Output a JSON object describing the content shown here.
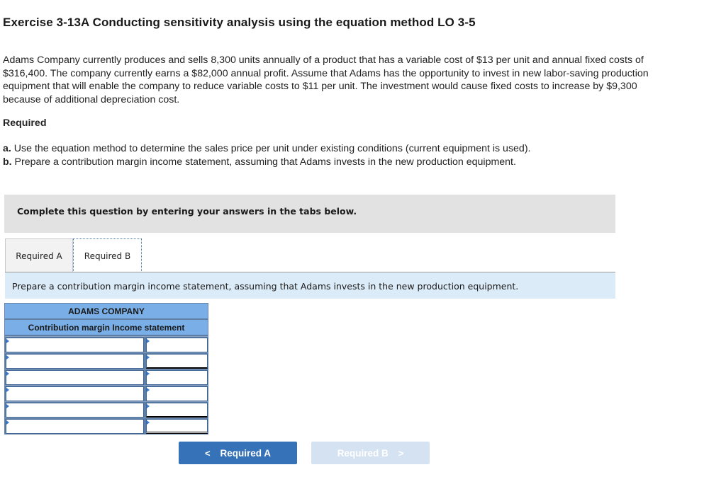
{
  "exercise": {
    "title": "Exercise 3-13A Conducting sensitivity analysis using the equation method LO 3-5",
    "problem_text": "Adams Company currently produces and sells 8,300 units annually of a product that has a variable cost of $13 per unit and annual fixed costs of $316,400. The company currently earns a $82,000 annual profit. Assume that Adams has the opportunity to invest in new labor-saving production equipment that will enable the company to reduce variable costs to $11 per unit. The investment would cause fixed costs to increase by $9,300 because of additional depreciation cost.",
    "required_heading": "Required",
    "requirements": [
      {
        "letter": "a.",
        "text": " Use the equation method to determine the sales price per unit under existing conditions (current equipment is used)."
      },
      {
        "letter": "b.",
        "text": " Prepare a contribution margin income statement, assuming that Adams invests in the new production equipment."
      }
    ]
  },
  "instruction": "Complete this question by entering your answers in the tabs below.",
  "tabs": [
    {
      "label": "Required A",
      "active": false
    },
    {
      "label": "Required B",
      "active": true
    }
  ],
  "prompt": "Prepare a contribution margin income statement, assuming that Adams invests in the new production equipment.",
  "statement": {
    "company": "ADAMS COMPANY",
    "title": "Contribution margin Income statement",
    "rows": [
      {
        "label": "",
        "value": ""
      },
      {
        "label": "",
        "value": ""
      },
      {
        "label": "",
        "value": ""
      },
      {
        "label": "",
        "value": ""
      },
      {
        "label": "",
        "value": ""
      },
      {
        "label": "",
        "value": ""
      }
    ]
  },
  "navigation": {
    "prev_label": "Required A",
    "next_label": "Required B",
    "prev_icon": "chevron-left-icon",
    "next_icon": "chevron-right-icon",
    "prev_glyph": "<",
    "next_glyph": ">"
  },
  "colors": {
    "header_blue": "#7aaee6",
    "prompt_bg": "#dcebf8",
    "primary_button": "#3572b8",
    "disabled_button": "#d5e2f1"
  }
}
